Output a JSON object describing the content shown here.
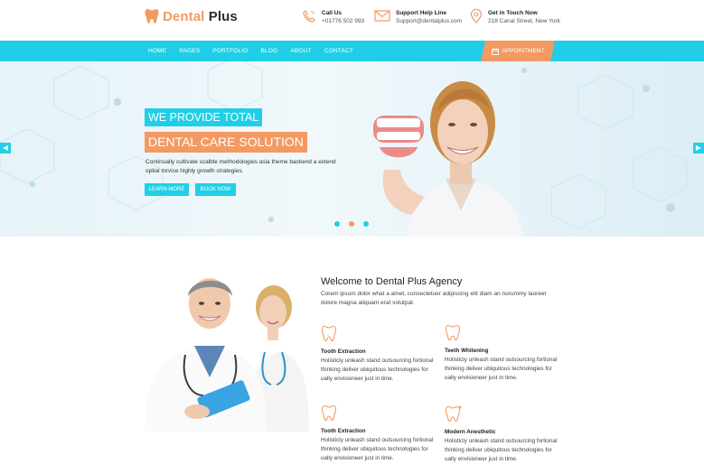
{
  "brand": {
    "word1": "Dental",
    "word2": "Plus"
  },
  "contact": [
    {
      "title": "Call Us",
      "value": "+01776 502 993",
      "icon": "phone-icon"
    },
    {
      "title": "Support Help Line",
      "value": "Support@dentalplus.com",
      "icon": "envelope-icon"
    },
    {
      "title": "Get in Touch Now",
      "value": "218 Canal Street, New York",
      "icon": "map-pin-icon"
    }
  ],
  "nav": {
    "items": [
      "HOME",
      "PAGES",
      "PORTFOLIO",
      "BLOG",
      "ABOUT",
      "CONTACT"
    ],
    "appointment": "APPOINTMENT"
  },
  "hero": {
    "tagline1": "WE PROVIDE TOTAL",
    "tagline2": "DENTAL CARE SOLUTION",
    "description": "Continually cultivate scalble methodologies asia theme backend a extend optial mrvice highly growth strategies.",
    "btn_learn": "LEARN MORE",
    "btn_book": "BOOK NOW",
    "slides": [
      {
        "state": "inactive",
        "color": "#20cfe7"
      },
      {
        "state": "active",
        "color": "#f39a63"
      },
      {
        "state": "inactive",
        "color": "#20cfe7"
      }
    ]
  },
  "about": {
    "title": "Welcome to Dental Plus Agency",
    "text": "Corem ipsum dolor what a amet, consectetuer adipiscing elit diam an norummy laoreet dolore magna aliquam erat volutpat.",
    "features": [
      {
        "title": "Tooth Extraction",
        "desc": "Holisticly unleash stand outsourcing fortional thinking deliver ubiquitous technologies for ually envisioneer just in time.",
        "icon": "tooth-icon"
      },
      {
        "title": "Teeth Whitening",
        "desc": "Holisticly unleash stand outsourcing fortional thinking deliver ubiquitous technologies for ually envisioneer just in time.",
        "icon": "tooth-icon"
      },
      {
        "title": "Tooth Extraction",
        "desc": "Holisticly unleash stand outsourcing fortional thinking deliver ubiquitous technologies for ually envisioneer just in time.",
        "icon": "tooth-icon"
      },
      {
        "title": "Modern Anesthetic",
        "desc": "Holisticly unleash stand outsourcing fortional thinking deliver ubiquitous technologies for ually envisioneer just in time.",
        "icon": "tooth-sparkle-icon"
      }
    ]
  },
  "colors": {
    "primary": "#20cfe7",
    "accent": "#f39a63"
  }
}
